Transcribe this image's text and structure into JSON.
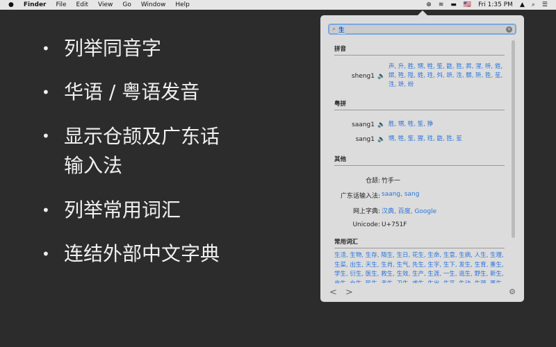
{
  "menubar": {
    "apple": "",
    "app": "Finder",
    "items": [
      "File",
      "Edit",
      "View",
      "Go",
      "Window",
      "Help"
    ],
    "clock": "Fri 1:35 PM",
    "flag": "🇺🇸"
  },
  "bullets": [
    "列举同音字",
    "华语 / 粤语发音",
    "显示仓颉及广东话\n输入法",
    "列举常用词汇",
    "连结外部中文字典"
  ],
  "popup": {
    "search_value": "生",
    "pinyin_title": "拼音",
    "pinyin": [
      {
        "reading": "sheng1",
        "chars": "声, 升, 胜, 甥, 牲, 笙, 鼪, 狌, 昇, 湦, 呏, 鉎, 焺, 殅, 陞, 鉎, 珄, 斘, 竔, 泩, 鵿, 阩, 狌, 苼, 泩, 竔, 纷"
      }
    ],
    "jyutping_title": "粤拼",
    "jyutping": [
      {
        "reading": "saang1",
        "chars": "胜, 甥, 牲, 笙, 狰"
      },
      {
        "reading": "sang1",
        "chars": "甥, 牲, 笙, 猩, 珄, 鼪, 狌, 苼"
      }
    ],
    "other_title": "其他",
    "other": [
      {
        "k": "仓颉:",
        "v": "竹手一",
        "link": false
      },
      {
        "k": "广东话输入法:",
        "v": "saang, sang",
        "link": true
      },
      {
        "k": "网上字典:",
        "v": "汉典, 百度, Google",
        "link": true
      },
      {
        "k": "Unicode:",
        "v": "U+751F",
        "link": false
      }
    ],
    "vocab_title": "常用词汇",
    "vocab": "生活, 生物, 生存, 陌生, 生日, 花生, 生命, 生意, 生病, 人生, 生理, 生菜, 出生, 天生, 生肖, 生气, 先生, 生字, 生下, 发生, 生育, 重生, 学生, 衍生, 医生, 救生, 生效, 生产, 生涯, 一生, 逃生, 野生, 新生, 产生, 女生, 民生, 考生, 卫生, 求生, 生出, 生平, 生动, 生疏, 再生,"
  }
}
